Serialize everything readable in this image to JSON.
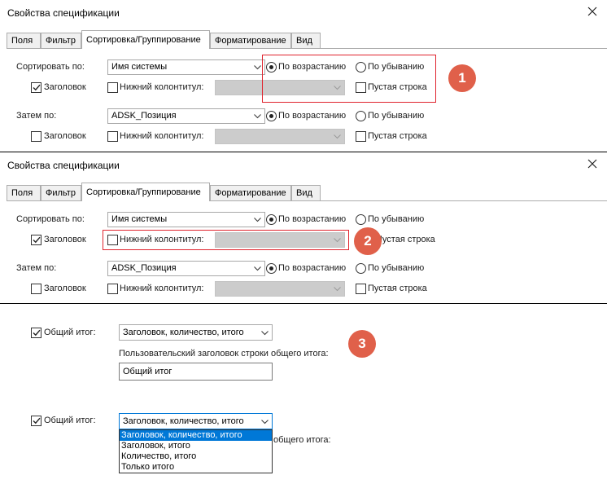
{
  "dialog": {
    "title": "Свойства спецификации",
    "tabs": [
      "Поля",
      "Фильтр",
      "Сортировка/Группирование",
      "Форматирование",
      "Вид"
    ]
  },
  "sort": {
    "sort_by_label": "Сортировать по:",
    "sort_by_value": "Имя системы",
    "ascending": "По возрастанию",
    "descending": "По убыванию",
    "header": "Заголовок",
    "footer": "Нижний колонтитул:",
    "blank_line": "Пустая строка",
    "then_by_label": "Затем по:",
    "then_by_value": "ADSK_Позиция"
  },
  "badges": [
    "1",
    "2",
    "3"
  ],
  "grand_total": {
    "label": "Общий итог:",
    "value": "Заголовок, количество, итого",
    "custom_title_label": "Пользовательский заголовок строки общего итога:",
    "custom_title_value": "Общий итог",
    "custom_title_label_partial": "общего итога:",
    "options": [
      "Заголовок, количество, итого",
      "Заголовок, итого",
      "Количество, итого",
      "Только итого"
    ]
  },
  "colors": {
    "accent_red": "#e0242e",
    "badge": "#e0604a",
    "selection": "#0078d7"
  },
  "icons": [
    "close-icon",
    "chevron-down-icon",
    "checkmark-icon"
  ]
}
